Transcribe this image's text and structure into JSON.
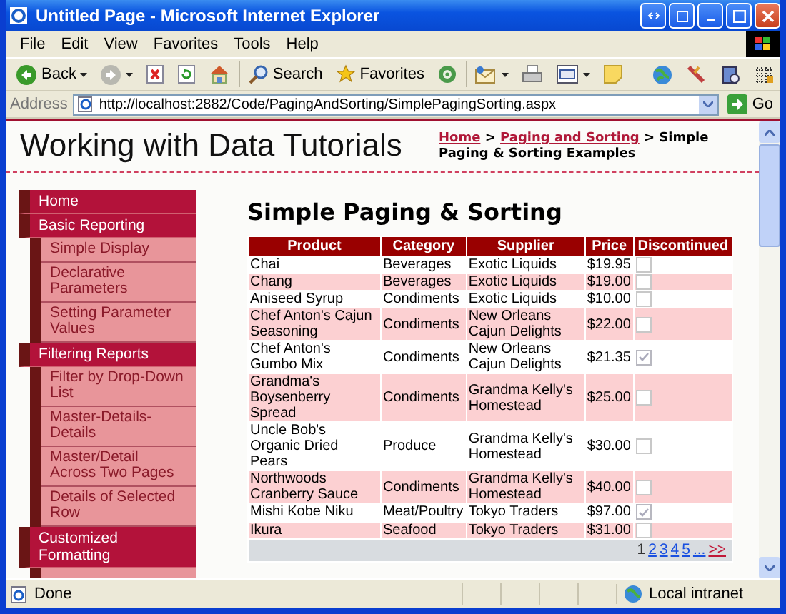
{
  "window": {
    "title": "Untitled Page - Microsoft Internet Explorer"
  },
  "menu": [
    "File",
    "Edit",
    "View",
    "Favorites",
    "Tools",
    "Help"
  ],
  "toolbar": [
    {
      "kind": "back",
      "label": "Back",
      "dropdown": true
    },
    {
      "kind": "forward",
      "dropdown": true
    },
    {
      "kind": "stop"
    },
    {
      "kind": "refresh"
    },
    {
      "kind": "home"
    },
    {
      "kind": "separator"
    },
    {
      "kind": "search",
      "label": "Search"
    },
    {
      "kind": "favorites",
      "label": "Favorites"
    },
    {
      "kind": "media"
    },
    {
      "kind": "separator"
    },
    {
      "kind": "mail",
      "dropdown": true
    },
    {
      "kind": "print"
    },
    {
      "kind": "edit",
      "dropdown": true
    },
    {
      "kind": "note"
    },
    {
      "kind": "spacer"
    },
    {
      "kind": "globe"
    },
    {
      "kind": "tools"
    },
    {
      "kind": "research"
    },
    {
      "kind": "grid"
    }
  ],
  "address": {
    "label": "Address",
    "value": "http://localhost:2882/Code/PagingAndSorting/SimplePagingSorting.aspx",
    "go": "Go"
  },
  "site": {
    "title": "Working with Data Tutorials",
    "separator": ">",
    "breadcrumb": [
      {
        "text": "Home",
        "kind": "link"
      },
      {
        "text": "Paging and Sorting",
        "kind": "link"
      },
      {
        "text": "Simple Paging & Sorting Examples",
        "kind": "current"
      }
    ]
  },
  "sidebar": {
    "items": [
      {
        "label": "Home"
      },
      {
        "label": "Basic Reporting",
        "children": [
          {
            "label": "Simple Display"
          },
          {
            "label": "Declarative Parameters"
          },
          {
            "label": "Setting Parameter Values"
          }
        ]
      },
      {
        "label": "Filtering Reports",
        "children": [
          {
            "label": "Filter by Drop-Down List"
          },
          {
            "label": "Master-Details-Details"
          },
          {
            "label": "Master/Detail Across Two Pages"
          },
          {
            "label": "Details of Selected Row"
          }
        ]
      },
      {
        "label": "Customized Formatting"
      }
    ]
  },
  "main": {
    "heading": "Simple Paging & Sorting",
    "table": {
      "columns": [
        "Product",
        "Category",
        "Supplier",
        "Price",
        "Discontinued"
      ],
      "rows": [
        {
          "product": "Chai",
          "category": "Beverages",
          "supplier": "Exotic Liquids",
          "price": "$19.95",
          "discontinued": false
        },
        {
          "product": "Chang",
          "category": "Beverages",
          "supplier": "Exotic Liquids",
          "price": "$19.00",
          "discontinued": false
        },
        {
          "product": "Aniseed Syrup",
          "category": "Condiments",
          "supplier": "Exotic Liquids",
          "price": "$10.00",
          "discontinued": false
        },
        {
          "product": "Chef Anton's Cajun Seasoning",
          "category": "Condiments",
          "supplier": "New Orleans Cajun Delights",
          "price": "$22.00",
          "discontinued": false
        },
        {
          "product": "Chef Anton's Gumbo Mix",
          "category": "Condiments",
          "supplier": "New Orleans Cajun Delights",
          "price": "$21.35",
          "discontinued": true
        },
        {
          "product": "Grandma's Boysenberry Spread",
          "category": "Condiments",
          "supplier": "Grandma Kelly's Homestead",
          "price": "$25.00",
          "discontinued": false
        },
        {
          "product": "Uncle Bob's Organic Dried Pears",
          "category": "Produce",
          "supplier": "Grandma Kelly's Homestead",
          "price": "$30.00",
          "discontinued": false
        },
        {
          "product": "Northwoods Cranberry Sauce",
          "category": "Condiments",
          "supplier": "Grandma Kelly's Homestead",
          "price": "$40.00",
          "discontinued": false
        },
        {
          "product": "Mishi Kobe Niku",
          "category": "Meat/Poultry",
          "supplier": "Tokyo Traders",
          "price": "$97.00",
          "discontinued": true
        },
        {
          "product": "Ikura",
          "category": "Seafood",
          "supplier": "Tokyo Traders",
          "price": "$31.00",
          "discontinued": false
        }
      ],
      "pager": [
        {
          "label": "1",
          "selected": true
        },
        {
          "label": "2",
          "selected": false
        },
        {
          "label": "3",
          "selected": false
        },
        {
          "label": "4",
          "selected": false
        },
        {
          "label": "5",
          "selected": false
        },
        {
          "label": "...",
          "selected": false
        },
        {
          "label": ">>",
          "selected": false
        }
      ]
    }
  },
  "status_bar": {
    "text": "Done",
    "zone": "Local intranet"
  }
}
